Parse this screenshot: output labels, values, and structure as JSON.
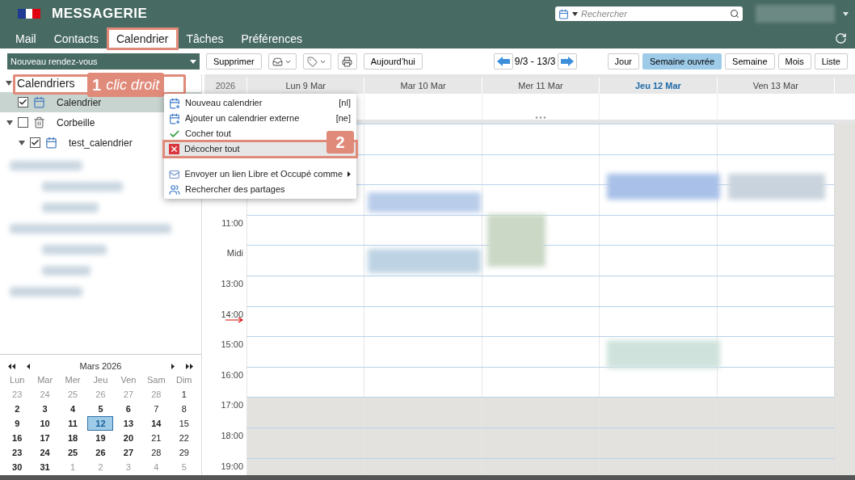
{
  "header": {
    "title": "MESSAGERIE",
    "search": {
      "placeholder": "Rechercher"
    }
  },
  "tabs": [
    {
      "label": "Mail",
      "selected": false
    },
    {
      "label": "Contacts",
      "selected": false
    },
    {
      "label": "Calendrier",
      "selected": true
    },
    {
      "label": "Tâches",
      "selected": false
    },
    {
      "label": "Préférences",
      "selected": false
    }
  ],
  "toolbar": {
    "new_button": "Nouveau rendez-vous",
    "delete_button": "Supprimer",
    "today_button": "Aujourd’hui",
    "range": "9/3 - 13/3"
  },
  "views": [
    {
      "label": "Jour",
      "selected": false
    },
    {
      "label": "Semaine ouvrée",
      "selected": true
    },
    {
      "label": "Semaine",
      "selected": false
    },
    {
      "label": "Mois",
      "selected": false
    },
    {
      "label": "Liste",
      "selected": false
    }
  ],
  "tree": {
    "label": "Calendriers",
    "expanded": true,
    "children": [
      {
        "kind": "calendar",
        "label": "Calendrier",
        "checked": true,
        "selected": true
      },
      {
        "kind": "trash",
        "label": "Corbeille",
        "checked": false,
        "selected": false,
        "expanded": true,
        "children": [
          {
            "kind": "calendar",
            "label": "test_calendrier",
            "checked": true,
            "selected": false,
            "expanded": true
          }
        ]
      }
    ]
  },
  "context_menu": [
    {
      "kind": "item",
      "label": "Nouveau calendrier",
      "shortcut": "[nl]",
      "highlighted": false
    },
    {
      "kind": "item",
      "label": "Ajouter un calendrier externe",
      "shortcut": "[ne]",
      "highlighted": false
    },
    {
      "kind": "item",
      "label": "Cocher tout",
      "highlighted": false
    },
    {
      "kind": "item",
      "label": "Décocher tout",
      "highlighted": true
    },
    {
      "kind": "separator"
    },
    {
      "kind": "item",
      "label": "Envoyer un lien Libre et Occupé comme",
      "highlighted": false,
      "submenu": true
    },
    {
      "kind": "item",
      "label": "Rechercher des partages",
      "highlighted": false
    }
  ],
  "annotations": [
    {
      "number": "1",
      "text": "clic droit"
    },
    {
      "number": "2"
    }
  ],
  "grid": {
    "year_label": "2026",
    "days": [
      {
        "label": "Lun 9 Mar",
        "today": false
      },
      {
        "label": "Mar 10 Mar",
        "today": false
      },
      {
        "label": "Mer 11 Mar",
        "today": false
      },
      {
        "label": "Jeu 12 Mar",
        "today": true
      },
      {
        "label": "Ven 13 Mar",
        "today": false
      }
    ],
    "hours": [
      "11:00",
      "Midi",
      "13:00",
      "14:00",
      "15:00",
      "16:00",
      "17:00",
      "18:00",
      "19:00"
    ]
  },
  "mini_calendar": {
    "title": "Mars 2026",
    "weekdays": [
      "Lun",
      "Mar",
      "Mer",
      "Jeu",
      "Ven",
      "Sam",
      "Dim"
    ],
    "weeks": [
      [
        {
          "d": "23",
          "outside": true,
          "bold": false,
          "selected": false
        },
        {
          "d": "24",
          "outside": true,
          "bold": false,
          "selected": false
        },
        {
          "d": "25",
          "outside": true,
          "bold": false,
          "selected": false
        },
        {
          "d": "26",
          "outside": true,
          "bold": false,
          "selected": false
        },
        {
          "d": "27",
          "outside": true,
          "bold": false,
          "selected": false
        },
        {
          "d": "28",
          "outside": true,
          "bold": false,
          "selected": false
        },
        {
          "d": "1",
          "outside": false,
          "bold": false,
          "selected": false
        }
      ],
      [
        {
          "d": "2",
          "outside": false,
          "bold": true,
          "selected": false
        },
        {
          "d": "3",
          "outside": false,
          "bold": true,
          "selected": false
        },
        {
          "d": "4",
          "outside": false,
          "bold": true,
          "selected": false
        },
        {
          "d": "5",
          "outside": false,
          "bold": true,
          "selected": false
        },
        {
          "d": "6",
          "outside": false,
          "bold": true,
          "selected": false
        },
        {
          "d": "7",
          "outside": false,
          "bold": false,
          "selected": false
        },
        {
          "d": "8",
          "outside": false,
          "bold": false,
          "selected": false
        }
      ],
      [
        {
          "d": "9",
          "outside": false,
          "bold": true,
          "selected": false
        },
        {
          "d": "10",
          "outside": false,
          "bold": true,
          "selected": false
        },
        {
          "d": "11",
          "outside": false,
          "bold": true,
          "selected": false
        },
        {
          "d": "12",
          "outside": false,
          "bold": true,
          "selected": true
        },
        {
          "d": "13",
          "outside": false,
          "bold": true,
          "selected": false
        },
        {
          "d": "14",
          "outside": false,
          "bold": true,
          "selected": false
        },
        {
          "d": "15",
          "outside": false,
          "bold": false,
          "selected": false
        }
      ],
      [
        {
          "d": "16",
          "outside": false,
          "bold": true,
          "selected": false
        },
        {
          "d": "17",
          "outside": false,
          "bold": true,
          "selected": false
        },
        {
          "d": "18",
          "outside": false,
          "bold": true,
          "selected": false
        },
        {
          "d": "19",
          "outside": false,
          "bold": true,
          "selected": false
        },
        {
          "d": "20",
          "outside": false,
          "bold": true,
          "selected": false
        },
        {
          "d": "21",
          "outside": false,
          "bold": false,
          "selected": false
        },
        {
          "d": "22",
          "outside": false,
          "bold": false,
          "selected": false
        }
      ],
      [
        {
          "d": "23",
          "outside": false,
          "bold": true,
          "selected": false
        },
        {
          "d": "24",
          "outside": false,
          "bold": true,
          "selected": false
        },
        {
          "d": "25",
          "outside": false,
          "bold": true,
          "selected": false
        },
        {
          "d": "26",
          "outside": false,
          "bold": true,
          "selected": false
        },
        {
          "d": "27",
          "outside": false,
          "bold": true,
          "selected": false
        },
        {
          "d": "28",
          "outside": false,
          "bold": false,
          "selected": false
        },
        {
          "d": "29",
          "outside": false,
          "bold": false,
          "selected": false
        }
      ],
      [
        {
          "d": "30",
          "outside": false,
          "bold": true,
          "selected": false
        },
        {
          "d": "31",
          "outside": false,
          "bold": true,
          "selected": false
        },
        {
          "d": "1",
          "outside": true,
          "bold": false,
          "selected": false
        },
        {
          "d": "2",
          "outside": true,
          "bold": false,
          "selected": false
        },
        {
          "d": "3",
          "outside": true,
          "bold": false,
          "selected": false
        },
        {
          "d": "4",
          "outside": true,
          "bold": false,
          "selected": false
        },
        {
          "d": "5",
          "outside": true,
          "bold": false,
          "selected": false
        }
      ]
    ]
  }
}
